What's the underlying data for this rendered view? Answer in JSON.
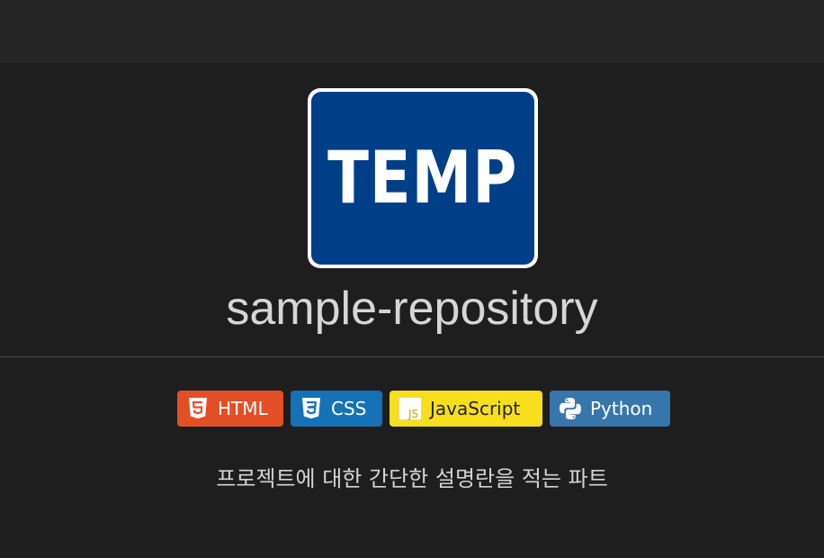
{
  "logo": {
    "text": "TEMP"
  },
  "repository": {
    "name": "sample-repository"
  },
  "badges": [
    {
      "label": "HTML",
      "icon": "html5-icon",
      "color": "#e34f26"
    },
    {
      "label": "CSS",
      "icon": "css3-icon",
      "color": "#1572b6"
    },
    {
      "label": "JavaScript",
      "icon": "javascript-icon",
      "color": "#f7df1e"
    },
    {
      "label": "Python",
      "icon": "python-icon",
      "color": "#3776ab"
    }
  ],
  "description": "프로젝트에 대한 간단한 설명란을 적는 파트"
}
